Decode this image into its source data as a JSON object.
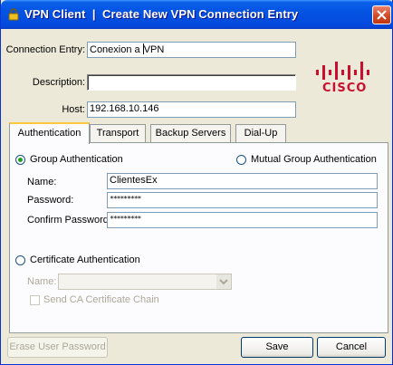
{
  "window": {
    "title": "VPN Client  |  Create New VPN Connection Entry",
    "icon": "lock-icon",
    "close_icon": "close-icon"
  },
  "connection_entry": {
    "label": "Connection Entry:",
    "value_before_caret": "Conexion a ",
    "value_after_caret": "VPN"
  },
  "description": {
    "label": "Description:",
    "value": ""
  },
  "host": {
    "label": "Host:",
    "value": "192.168.10.146"
  },
  "logo": {
    "text": "CISCO",
    "color": "#c8102e"
  },
  "tabs": [
    {
      "label": "Authentication",
      "active": true
    },
    {
      "label": "Transport",
      "active": false
    },
    {
      "label": "Backup Servers",
      "active": false
    },
    {
      "label": "Dial-Up",
      "active": false
    }
  ],
  "auth": {
    "group_auth": {
      "label": "Group Authentication",
      "checked": true
    },
    "mutual_group_auth": {
      "label": "Mutual Group Authentication",
      "checked": false
    },
    "name": {
      "label": "Name:",
      "value": "ClientesEx"
    },
    "password": {
      "label": "Password:",
      "value": "*********"
    },
    "confirm_password": {
      "label": "Confirm Password:",
      "value": "*********"
    },
    "certificate_auth": {
      "label": "Certificate Authentication",
      "checked": false
    },
    "cert_name": {
      "label": "Name:",
      "value": ""
    },
    "send_ca_chain": {
      "label": "Send CA Certificate Chain",
      "checked": false
    }
  },
  "buttons": {
    "erase_password": "Erase User Password",
    "save": "Save",
    "cancel": "Cancel"
  }
}
